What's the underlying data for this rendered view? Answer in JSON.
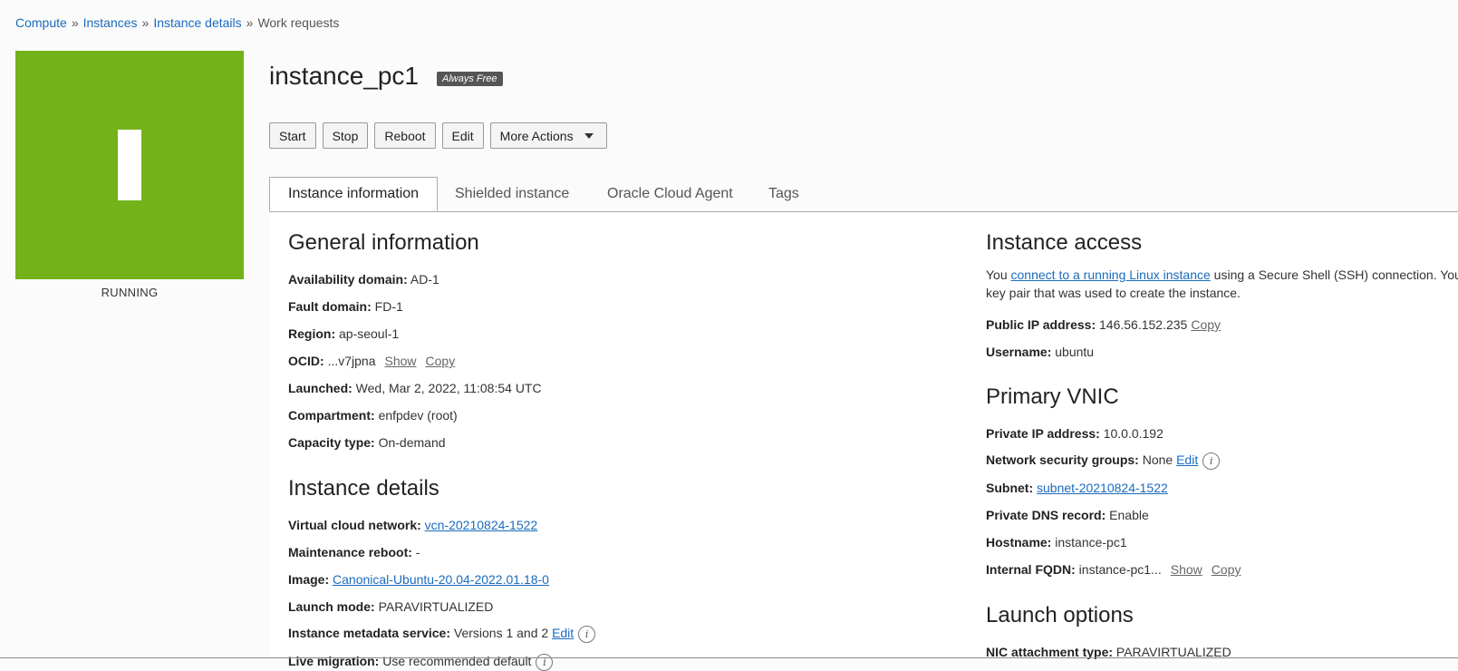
{
  "breadcrumb": {
    "items": [
      "Compute",
      "Instances",
      "Instance details"
    ],
    "current": "Work requests",
    "separator": "»"
  },
  "status": {
    "text": "RUNNING",
    "color": "#74b21a"
  },
  "instance": {
    "name": "instance_pc1",
    "badge": "Always Free"
  },
  "toolbar": {
    "start": "Start",
    "stop": "Stop",
    "reboot": "Reboot",
    "edit": "Edit",
    "more_actions": "More Actions"
  },
  "tabs": [
    {
      "label": "Instance information",
      "active": true
    },
    {
      "label": "Shielded instance",
      "active": false
    },
    {
      "label": "Oracle Cloud Agent",
      "active": false
    },
    {
      "label": "Tags",
      "active": false
    }
  ],
  "general": {
    "heading": "General information",
    "availability_domain": {
      "label": "Availability domain:",
      "value": "AD-1"
    },
    "fault_domain": {
      "label": "Fault domain:",
      "value": "FD-1"
    },
    "region": {
      "label": "Region:",
      "value": "ap-seoul-1"
    },
    "ocid": {
      "label": "OCID:",
      "value": "...v7jpna",
      "show": "Show",
      "copy": "Copy"
    },
    "launched": {
      "label": "Launched:",
      "value": "Wed, Mar 2, 2022, 11:08:54 UTC"
    },
    "compartment": {
      "label": "Compartment:",
      "value": "enfpdev (root)"
    },
    "capacity_type": {
      "label": "Capacity type:",
      "value": "On-demand"
    }
  },
  "details": {
    "heading": "Instance details",
    "vcn": {
      "label": "Virtual cloud network:",
      "value": "vcn-20210824-1522"
    },
    "maintenance_reboot": {
      "label": "Maintenance reboot:",
      "value": "-"
    },
    "image": {
      "label": "Image:",
      "value": "Canonical-Ubuntu-20.04-2022.01.18-0"
    },
    "launch_mode": {
      "label": "Launch mode:",
      "value": "PARAVIRTUALIZED"
    },
    "metadata_service": {
      "label": "Instance metadata service:",
      "value": "Versions 1 and 2",
      "edit": "Edit"
    },
    "live_migration": {
      "label": "Live migration:",
      "value": "Use recommended default"
    }
  },
  "access": {
    "heading": "Instance access",
    "text_before": "You ",
    "link": "connect to a running Linux instance",
    "text_after": " using a Secure Shell (SSH) connection. You",
    "line2": "key pair that was used to create the instance.",
    "public_ip": {
      "label": "Public IP address:",
      "value": "146.56.152.235",
      "copy": "Copy"
    },
    "username": {
      "label": "Username:",
      "value": "ubuntu"
    }
  },
  "vnic": {
    "heading": "Primary VNIC",
    "private_ip": {
      "label": "Private IP address:",
      "value": "10.0.0.192"
    },
    "nsg": {
      "label": "Network security groups:",
      "value": "None",
      "edit": "Edit"
    },
    "subnet": {
      "label": "Subnet:",
      "value": "subnet-20210824-1522"
    },
    "private_dns": {
      "label": "Private DNS record:",
      "value": "Enable"
    },
    "hostname": {
      "label": "Hostname:",
      "value": "instance-pc1"
    },
    "fqdn": {
      "label": "Internal FQDN:",
      "value": "instance-pc1...",
      "show": "Show",
      "copy": "Copy"
    }
  },
  "launch_options": {
    "heading": "Launch options",
    "nic_attachment": {
      "label": "NIC attachment type:",
      "value": "PARAVIRTUALIZED"
    }
  }
}
